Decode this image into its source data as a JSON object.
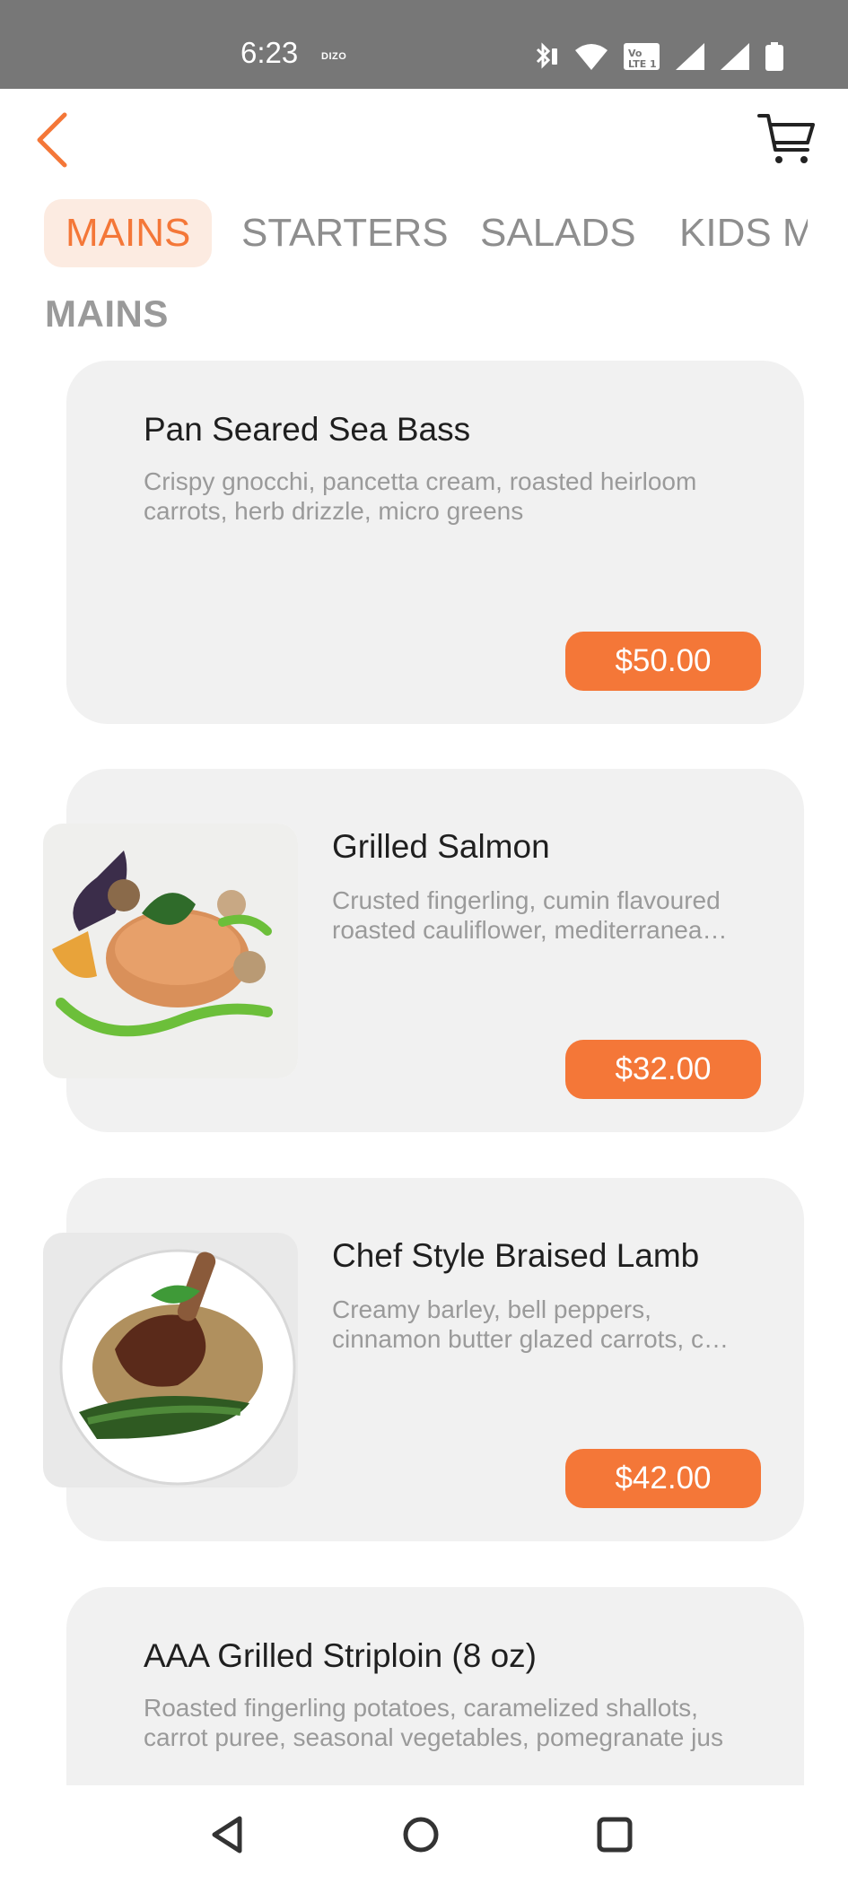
{
  "status_bar": {
    "time": "6:23",
    "carrier": "DIZO",
    "network_label": "Vo LTE 1",
    "icons": [
      "bluetooth-icon",
      "wifi-icon",
      "volte-icon",
      "signal-icon",
      "signal-icon",
      "battery-icon"
    ]
  },
  "header": {
    "back_icon": "chevron-left-icon",
    "cart_icon": "cart-icon",
    "accent_color": "#f47738"
  },
  "tabs": [
    {
      "label": "MAINS",
      "active": true
    },
    {
      "label": "STARTERS",
      "active": false
    },
    {
      "label": "SALADS",
      "active": false
    },
    {
      "label": "KIDS MENU",
      "active": false
    }
  ],
  "section_title": "MAINS",
  "menu_items": [
    {
      "name": "Pan Seared Sea Bass",
      "description": "Crispy gnocchi, pancetta cream, roasted heirloom carrots, herb drizzle, micro greens",
      "price": "$50.00",
      "has_image": false
    },
    {
      "name": "Grilled Salmon",
      "description": "Crusted fingerling, cumin flavoured roasted cauliflower, mediterranea…",
      "price": "$32.00",
      "has_image": true
    },
    {
      "name": "Chef Style Braised Lamb",
      "description": "Creamy barley, bell peppers, cinnamon butter glazed carrots, c…",
      "price": "$42.00",
      "has_image": true
    },
    {
      "name": "AAA Grilled Striploin (8 oz)",
      "description": "Roasted fingerling potatoes, caramelized shallots, carrot puree, seasonal vegetables, pomegranate jus",
      "price": "",
      "has_image": false
    }
  ],
  "nav_bar": {
    "back_icon": "triangle-back-icon",
    "home_icon": "circle-home-icon",
    "recents_icon": "square-recents-icon"
  }
}
